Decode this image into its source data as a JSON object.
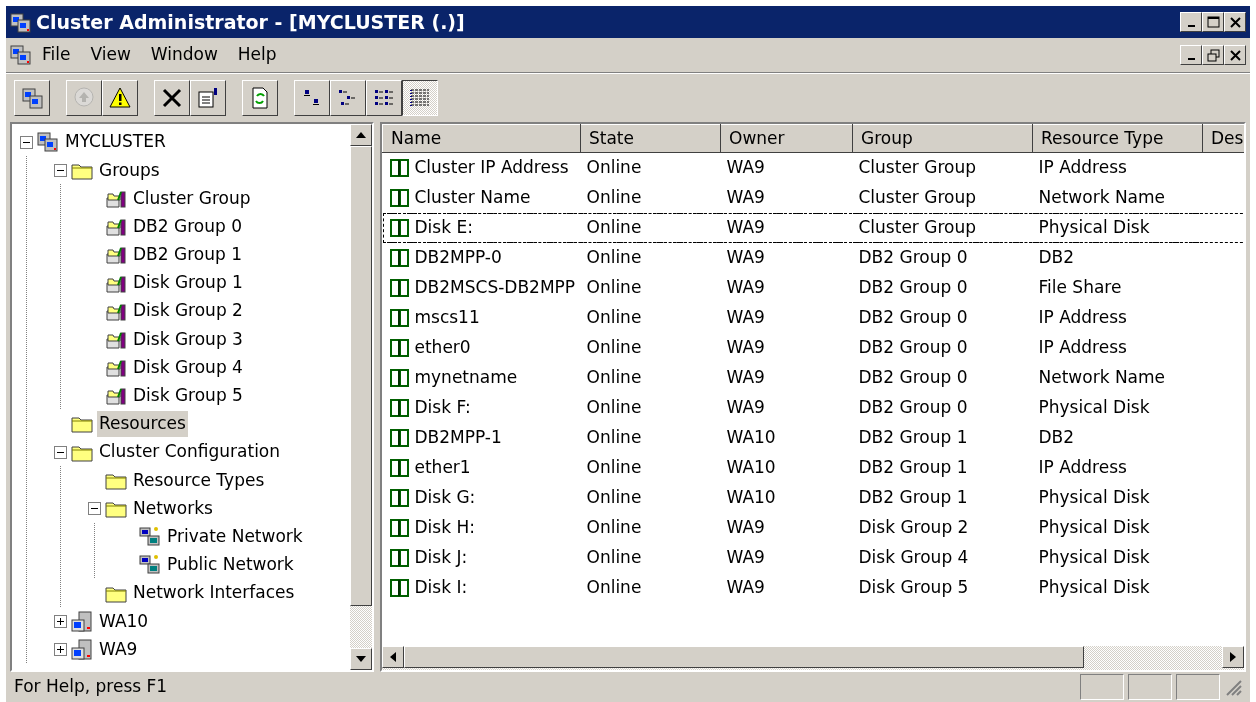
{
  "window": {
    "title": "Cluster Administrator - [MYCLUSTER (.)]"
  },
  "menu": [
    "File",
    "View",
    "Window",
    "Help"
  ],
  "toolbar": [
    {
      "buttons": [
        {
          "kind": "cluster",
          "disabled": false,
          "pressed": false
        }
      ]
    },
    {
      "buttons": [
        {
          "kind": "online",
          "disabled": true,
          "pressed": false
        },
        {
          "kind": "warning",
          "disabled": false,
          "pressed": false
        }
      ]
    },
    {
      "buttons": [
        {
          "kind": "delete",
          "disabled": false,
          "pressed": false
        },
        {
          "kind": "properties",
          "disabled": false,
          "pressed": false
        }
      ]
    },
    {
      "buttons": [
        {
          "kind": "refresh",
          "disabled": false,
          "pressed": false
        }
      ]
    },
    {
      "buttons": [
        {
          "kind": "largeicons",
          "disabled": false,
          "pressed": false
        },
        {
          "kind": "smallicons",
          "disabled": false,
          "pressed": false
        },
        {
          "kind": "list",
          "disabled": false,
          "pressed": false
        },
        {
          "kind": "details",
          "disabled": false,
          "pressed": true
        }
      ]
    }
  ],
  "tree": [
    {
      "label": "MYCLUSTER",
      "kind": "cluster",
      "selected": false,
      "expanded": true,
      "children": [
        {
          "label": "Groups",
          "kind": "folder",
          "selected": false,
          "expanded": true,
          "children": [
            {
              "label": "Cluster Group",
              "kind": "group",
              "selected": false
            },
            {
              "label": "DB2 Group 0",
              "kind": "group",
              "selected": false
            },
            {
              "label": "DB2 Group 1",
              "kind": "group",
              "selected": false
            },
            {
              "label": "Disk Group 1",
              "kind": "group",
              "selected": false
            },
            {
              "label": "Disk Group 2",
              "kind": "group",
              "selected": false
            },
            {
              "label": "Disk Group 3",
              "kind": "group",
              "selected": false
            },
            {
              "label": "Disk Group 4",
              "kind": "group",
              "selected": false
            },
            {
              "label": "Disk Group 5",
              "kind": "group",
              "selected": false
            }
          ]
        },
        {
          "label": "Resources",
          "kind": "folder",
          "selected": true
        },
        {
          "label": "Cluster Configuration",
          "kind": "folder",
          "selected": false,
          "expanded": true,
          "children": [
            {
              "label": "Resource Types",
              "kind": "folder",
              "selected": false
            },
            {
              "label": "Networks",
              "kind": "folder",
              "selected": false,
              "expanded": true,
              "children": [
                {
                  "label": "Private Network",
                  "kind": "network",
                  "selected": false
                },
                {
                  "label": "Public Network",
                  "kind": "network",
                  "selected": false
                }
              ]
            },
            {
              "label": "Network Interfaces",
              "kind": "folder",
              "selected": false
            }
          ]
        },
        {
          "label": "WA10",
          "kind": "node",
          "selected": false,
          "expanded": false
        },
        {
          "label": "WA9",
          "kind": "node",
          "selected": false,
          "expanded": false
        }
      ]
    }
  ],
  "table": {
    "columns": [
      "Name",
      "State",
      "Owner",
      "Group",
      "Resource Type",
      "Des"
    ],
    "rows": [
      {
        "cells": [
          "Cluster IP Address",
          "Online",
          "WA9",
          "Cluster Group",
          "IP Address"
        ],
        "focused": false
      },
      {
        "cells": [
          "Cluster Name",
          "Online",
          "WA9",
          "Cluster Group",
          "Network Name"
        ],
        "focused": false
      },
      {
        "cells": [
          "Disk E:",
          "Online",
          "WA9",
          "Cluster Group",
          "Physical Disk"
        ],
        "focused": true
      },
      {
        "cells": [
          "DB2MPP-0",
          "Online",
          "WA9",
          "DB2 Group 0",
          "DB2"
        ],
        "focused": false
      },
      {
        "cells": [
          "DB2MSCS-DB2MPP",
          "Online",
          "WA9",
          "DB2 Group 0",
          "File Share"
        ],
        "focused": false
      },
      {
        "cells": [
          "mscs11",
          "Online",
          "WA9",
          "DB2 Group 0",
          "IP Address"
        ],
        "focused": false
      },
      {
        "cells": [
          "ether0",
          "Online",
          "WA9",
          "DB2 Group 0",
          "IP Address"
        ],
        "focused": false
      },
      {
        "cells": [
          "mynetname",
          "Online",
          "WA9",
          "DB2 Group 0",
          "Network Name"
        ],
        "focused": false
      },
      {
        "cells": [
          "Disk F:",
          "Online",
          "WA9",
          "DB2 Group 0",
          "Physical Disk"
        ],
        "focused": false
      },
      {
        "cells": [
          "DB2MPP-1",
          "Online",
          "WA10",
          "DB2 Group 1",
          "DB2"
        ],
        "focused": false
      },
      {
        "cells": [
          "ether1",
          "Online",
          "WA10",
          "DB2 Group 1",
          "IP Address"
        ],
        "focused": false
      },
      {
        "cells": [
          "Disk G:",
          "Online",
          "WA10",
          "DB2 Group 1",
          "Physical Disk"
        ],
        "focused": false
      },
      {
        "cells": [
          "Disk H:",
          "Online",
          "WA9",
          "Disk Group 2",
          "Physical Disk"
        ],
        "focused": false
      },
      {
        "cells": [
          "Disk J:",
          "Online",
          "WA9",
          "Disk Group 4",
          "Physical Disk"
        ],
        "focused": false
      },
      {
        "cells": [
          "Disk I:",
          "Online",
          "WA9",
          "Disk Group 5",
          "Physical Disk"
        ],
        "focused": false
      }
    ]
  },
  "status_bar": {
    "text": "For Help, press F1"
  }
}
